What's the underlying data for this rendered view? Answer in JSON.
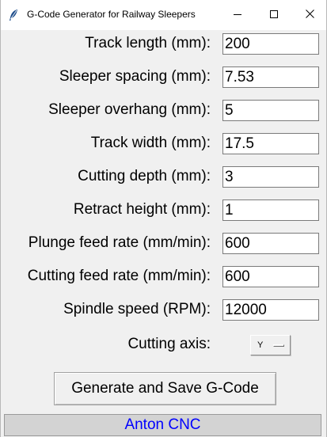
{
  "window": {
    "title": "G-Code Generator for Railway Sleepers",
    "icons": [
      "feather-icon",
      "minimize-icon",
      "maximize-icon",
      "close-icon"
    ]
  },
  "fields": [
    {
      "label": "Track length (mm):",
      "value": "200"
    },
    {
      "label": "Sleeper spacing (mm):",
      "value": "7.53"
    },
    {
      "label": "Sleeper overhang (mm):",
      "value": "5"
    },
    {
      "label": "Track width (mm):",
      "value": "17.5"
    },
    {
      "label": "Cutting depth (mm):",
      "value": "3"
    },
    {
      "label": "Retract height (mm):",
      "value": "1"
    },
    {
      "label": "Plunge feed rate (mm/min):",
      "value": "600"
    },
    {
      "label": "Cutting feed rate (mm/min):",
      "value": "600"
    },
    {
      "label": "Spindle speed (RPM):",
      "value": "12000"
    }
  ],
  "cutting_axis": {
    "label": "Cutting axis:",
    "value": "Y"
  },
  "generate_button": {
    "label": "Generate and Save G-Code"
  },
  "footer": {
    "text": "Anton CNC",
    "color": "#0000ff"
  }
}
